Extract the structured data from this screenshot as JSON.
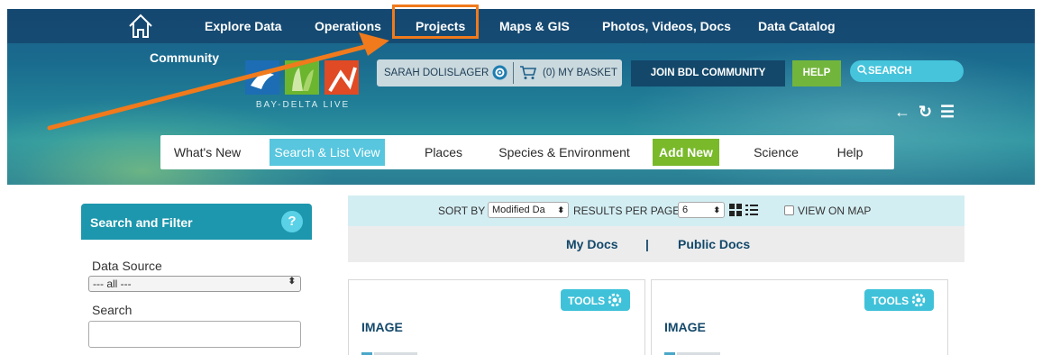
{
  "topnav": {
    "items": [
      "Explore Data",
      "Operations",
      "Projects",
      "Maps & GIS",
      "Photos, Videos, Docs",
      "Data Catalog"
    ],
    "community": "Community"
  },
  "logo": {
    "text": "BAY-DELTA LIVE"
  },
  "user": {
    "name": "SARAH DOLISLAGER",
    "basket": "(0) MY BASKET"
  },
  "header_buttons": {
    "join": "JOIN BDL COMMUNITY",
    "help": "HELP",
    "search": "SEARCH"
  },
  "header_icons": {
    "back": "←",
    "refresh": "↻",
    "menu": "☰"
  },
  "subnav": {
    "items": [
      "What's New",
      "Search & List View",
      "Places",
      "Species & Environment",
      "Add New",
      "Science",
      "Help"
    ],
    "active": "Search & List View"
  },
  "filter": {
    "title": "Search and Filter",
    "help": "?",
    "data_source_label": "Data Source",
    "data_source_value": "--- all ---",
    "search_label": "Search",
    "search_value": ""
  },
  "sortbar": {
    "sort_by_label": "SORT BY",
    "sort_by_value": "Modified Da",
    "results_label": "RESULTS PER PAGE",
    "results_value": "6",
    "view_on_map": "VIEW ON MAP"
  },
  "docs": {
    "my_docs": "My Docs",
    "divider": "|",
    "public_docs": "Public Docs"
  },
  "cards": [
    {
      "tools": "TOOLS",
      "type": "IMAGE"
    },
    {
      "tools": "TOOLS",
      "type": "IMAGE"
    }
  ],
  "colors": {
    "annotation": "#f07a1c",
    "accent": "#3fc2d9",
    "green": "#79b92a",
    "dark_blue": "#13486a"
  }
}
